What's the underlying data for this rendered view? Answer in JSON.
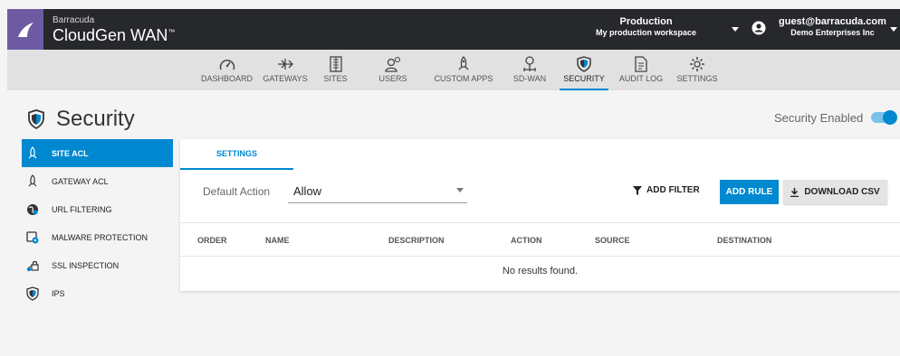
{
  "brand": {
    "vendor": "Barracuda",
    "product": "CloudGen WAN",
    "tm": "™"
  },
  "workspace": {
    "title": "Production",
    "subtitle": "My production workspace"
  },
  "user": {
    "email": "guest@barracuda.com",
    "org": "Demo Enterprises Inc"
  },
  "nav": [
    {
      "label": "DASHBOARD",
      "icon": "gauge-icon"
    },
    {
      "label": "GATEWAYS",
      "icon": "gateway-icon"
    },
    {
      "label": "SITES",
      "icon": "building-icon"
    },
    {
      "label": "USERS",
      "icon": "users-icon"
    },
    {
      "label": "CUSTOM APPS",
      "icon": "rocket-icon"
    },
    {
      "label": "SD-WAN",
      "icon": "network-icon"
    },
    {
      "label": "SECURITY",
      "icon": "shield-icon",
      "active": true
    },
    {
      "label": "AUDIT LOG",
      "icon": "document-icon"
    },
    {
      "label": "SETTINGS",
      "icon": "gear-icon"
    }
  ],
  "page": {
    "title": "Security",
    "security_enabled_label": "Security Enabled",
    "security_enabled": true
  },
  "sidebar": [
    {
      "label": "SITE ACL",
      "icon": "rocket-icon",
      "active": true
    },
    {
      "label": "GATEWAY ACL",
      "icon": "rocket-icon"
    },
    {
      "label": "URL FILTERING",
      "icon": "globe-icon"
    },
    {
      "label": "MALWARE PROTECTION",
      "icon": "malware-icon"
    },
    {
      "label": "SSL INSPECTION",
      "icon": "ssl-icon"
    },
    {
      "label": "IPS",
      "icon": "shield-icon"
    }
  ],
  "panel": {
    "tab": "SETTINGS",
    "default_action_label": "Default Action",
    "default_action_value": "Allow",
    "add_filter": "ADD FILTER",
    "add_rule": "ADD RULE",
    "download_csv": "DOWNLOAD CSV",
    "columns": [
      "ORDER",
      "NAME",
      "DESCRIPTION",
      "ACTION",
      "SOURCE",
      "DESTINATION"
    ],
    "empty_message": "No results found."
  },
  "colors": {
    "accent": "#0088d1",
    "topbar": "#26282b",
    "logo": "#6e5aa3",
    "navbar": "#e1e1e1"
  }
}
